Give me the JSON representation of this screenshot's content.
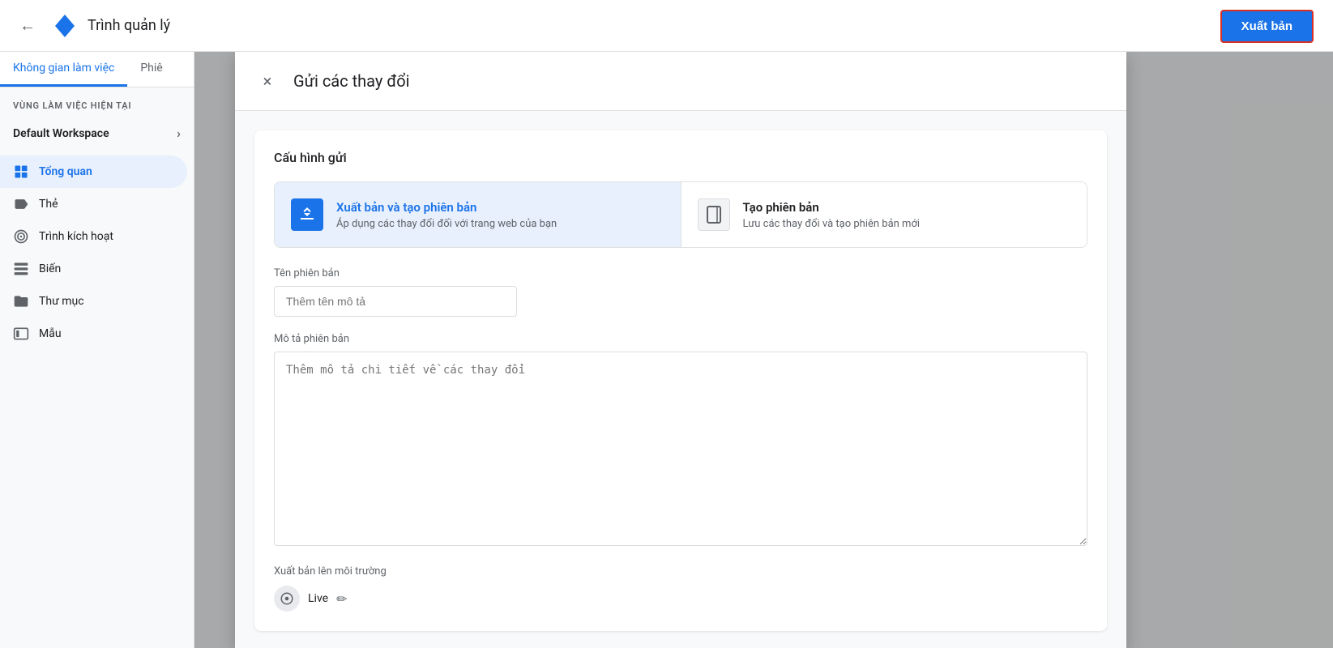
{
  "header": {
    "back_label": "←",
    "app_title": "Trình quản lý",
    "publish_button_label": "Xuất bản"
  },
  "sidebar": {
    "tabs": [
      {
        "label": "Không gian làm việc",
        "active": true
      },
      {
        "label": "Phiê",
        "active": false
      }
    ],
    "section_label": "VÙNG LÀM VIỆC HIỆN TẠI",
    "workspace_name": "Default Workspace",
    "nav_items": [
      {
        "label": "Tổng quan",
        "icon": "grid",
        "active": true
      },
      {
        "label": "Thẻ",
        "icon": "tag",
        "active": false
      },
      {
        "label": "Trình kích hoạt",
        "icon": "circle-target",
        "active": false
      },
      {
        "label": "Biến",
        "icon": "grid-small",
        "active": false
      },
      {
        "label": "Thư mục",
        "icon": "folder",
        "active": false
      },
      {
        "label": "Mẫu",
        "icon": "id-card",
        "active": false
      }
    ]
  },
  "dialog": {
    "title": "Gửi các thay đổi",
    "close_label": "×",
    "config_section_title": "Cấu hình gửi",
    "options": [
      {
        "id": "publish-and-version",
        "title": "Xuất bản và tạo phiên bản",
        "subtitle": "Áp dụng các thay đổi đối với trang web của bạn",
        "selected": true,
        "icon_type": "blue"
      },
      {
        "id": "create-version",
        "title": "Tạo phiên bản",
        "subtitle": "Lưu các thay đổi và tạo phiên bản mới",
        "selected": false,
        "icon_type": "gray"
      }
    ],
    "version_name_label": "Tên phiên bản",
    "version_name_placeholder": "Thêm tên mô tả",
    "version_desc_label": "Mô tả phiên bản",
    "version_desc_placeholder": "Thêm mô tả chi tiết về các thay đổi",
    "env_label": "Xuất bản lên môi trường",
    "env_name": "Live",
    "edit_icon_label": "✏"
  }
}
